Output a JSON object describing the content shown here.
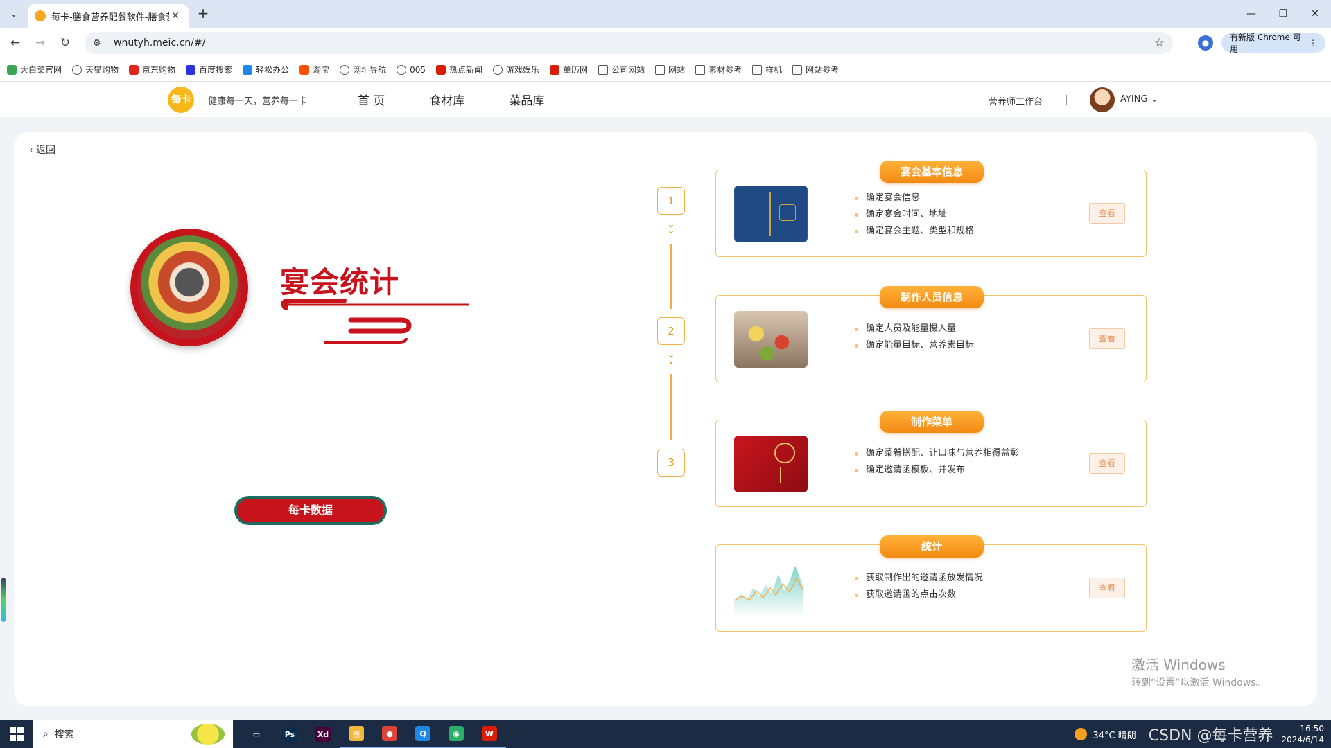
{
  "browser": {
    "tab_title": "每卡-膳食营养配餐软件-膳食营养",
    "tab_close": "✕",
    "new_tab": "+",
    "url": "wnutyh.meic.cn/#/",
    "update_label": "有新版 Chrome 可用",
    "bookmarks": [
      {
        "label": "大白菜官网",
        "icon": "leaf-icon",
        "color": "#3aa655"
      },
      {
        "label": "天猫购物",
        "icon": "globe-icon",
        "color": "#555555"
      },
      {
        "label": "京东购物",
        "icon": "jd-icon",
        "color": "#e1251b"
      },
      {
        "label": "百度搜索",
        "icon": "paw-icon",
        "color": "#2932e1"
      },
      {
        "label": "轻松办公",
        "icon": "office-icon",
        "color": "#1e88e5"
      },
      {
        "label": "淘宝",
        "icon": "taobao-icon",
        "color": "#ff5000"
      },
      {
        "label": "网址导航",
        "icon": "globe-icon",
        "color": "#555555"
      },
      {
        "label": "005",
        "icon": "globe-icon",
        "color": "#555555"
      },
      {
        "label": "热点新闻",
        "icon": "news-icon",
        "color": "#d81e06"
      },
      {
        "label": "游戏娱乐",
        "icon": "globe-icon",
        "color": "#555555"
      },
      {
        "label": "董历网",
        "icon": "calendar-icon",
        "color": "#d81e06"
      },
      {
        "label": "公司网站",
        "icon": "folder-icon",
        "color": "#555555"
      },
      {
        "label": "网站",
        "icon": "folder-icon",
        "color": "#555555"
      },
      {
        "label": "素材参考",
        "icon": "folder-icon",
        "color": "#555555"
      },
      {
        "label": "样机",
        "icon": "folder-icon",
        "color": "#555555"
      },
      {
        "label": "网站参考",
        "icon": "folder-icon",
        "color": "#555555"
      }
    ]
  },
  "header": {
    "logo_text": "每卡",
    "slogan": "健康每一天，营养每一卡",
    "nav": [
      "首 页",
      "食材库",
      "菜品库"
    ],
    "workbench": "营养师工作台",
    "username": "AYING"
  },
  "page": {
    "back_label": "返回",
    "hero_title": "宴会统计",
    "badge_label": "每卡数据"
  },
  "steps": [
    {
      "number": "1",
      "title": "宴会基本信息",
      "items": [
        "确定宴会信息",
        "确定宴会时间、地址",
        "确定宴会主题、类型和规格"
      ],
      "button": "查看",
      "thumb": "invitation-book"
    },
    {
      "number": "2",
      "title": "制作人员信息",
      "items": [
        "确定人员及能量摄入量",
        "确定能量目标、营养素目标"
      ],
      "button": "查看",
      "thumb": "banquet-food"
    },
    {
      "number": "3",
      "title": "制作菜单",
      "items": [
        "确定菜肴搭配、让口味与营养相得益彰",
        "确定邀请函模板、并发布"
      ],
      "button": "查看",
      "thumb": "red-invitation"
    },
    {
      "number": "",
      "title": "统计",
      "items": [
        "获取制作出的邀请函放发情况",
        "获取邀请函的点击次数"
      ],
      "button": "查看",
      "thumb": "area-chart"
    }
  ],
  "watermark": {
    "line1": "激活 Windows",
    "line2": "转到“设置”以激活 Windows。"
  },
  "taskbar": {
    "search_label": "搜索",
    "weather": "34°C 晴朗",
    "csdn": "CSDN @每卡营养",
    "time": "16:50",
    "date": "2024/6/14",
    "apps": [
      {
        "name": "task-view-icon",
        "label": "▭",
        "color": "#1c2b44"
      },
      {
        "name": "photoshop-icon",
        "label": "Ps",
        "color": "#0a2d4f"
      },
      {
        "name": "xd-icon",
        "label": "Xd",
        "color": "#470137"
      },
      {
        "name": "file-explorer-icon",
        "label": "▤",
        "color": "#f3b73b"
      },
      {
        "name": "chrome-icon",
        "label": "●",
        "color": "#db4437"
      },
      {
        "name": "search-app-icon",
        "label": "Q",
        "color": "#1e88e5"
      },
      {
        "name": "wechat-icon",
        "label": "◉",
        "color": "#2aae67"
      },
      {
        "name": "wps-icon",
        "label": "W",
        "color": "#d81e06"
      }
    ]
  },
  "colors": {
    "brand_red": "#c7131b",
    "accent_orange": "#f38a12",
    "card_border": "#f5c36a"
  }
}
